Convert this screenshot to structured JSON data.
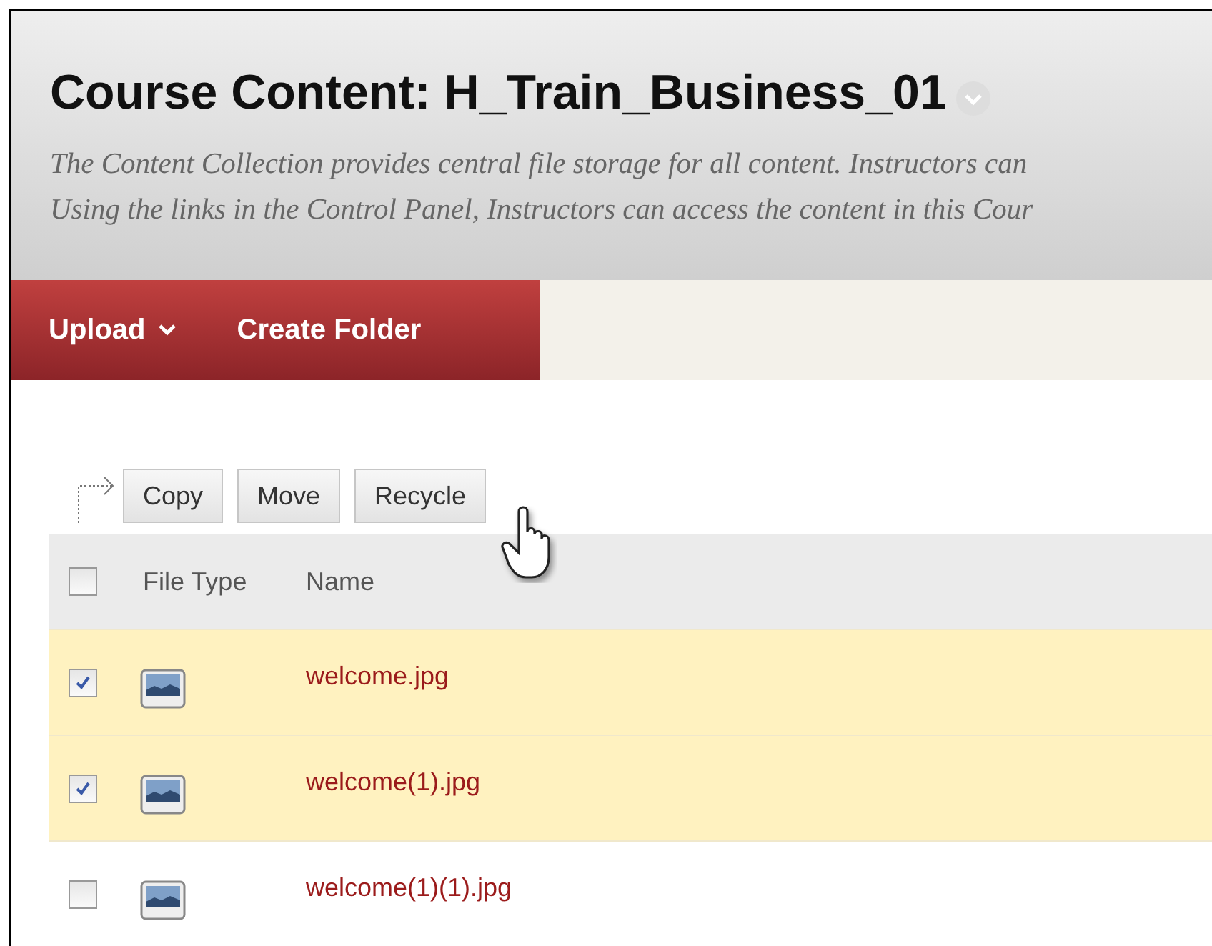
{
  "page_header": {
    "title": "Course Content: H_Train_Business_01",
    "description": [
      "The Content Collection provides central file storage for all content. Instructors can",
      "Using the links in the Control Panel, Instructors can access the content in this Cour"
    ]
  },
  "action_bar": [
    {
      "label": "Upload",
      "kind": "menu"
    },
    {
      "label": "Create Folder",
      "kind": "button"
    }
  ],
  "toolbar": {
    "buttons": [
      "Copy",
      "Move",
      "Recycle"
    ]
  },
  "table": {
    "select_all": {
      "checked": false
    },
    "columns": [
      "File Type",
      "Name"
    ],
    "rows": [
      {
        "name": "welcome.jpg",
        "checked": true
      },
      {
        "name": "welcome(1).jpg",
        "checked": true
      },
      {
        "name": "welcome(1)(1).jpg",
        "checked": false
      }
    ]
  }
}
